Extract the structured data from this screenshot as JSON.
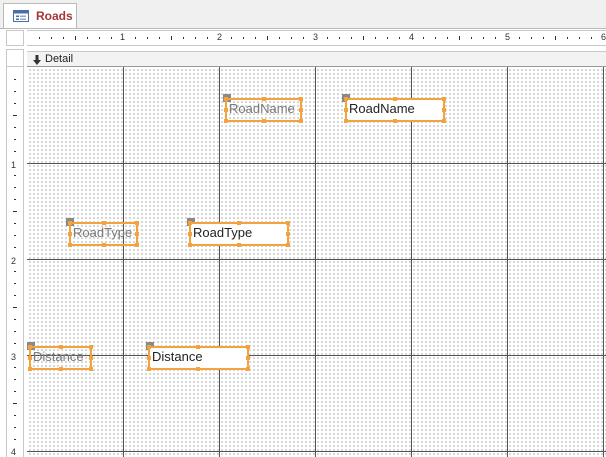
{
  "tab": {
    "title": "Roads",
    "icon": "form-icon"
  },
  "ruler": {
    "horizontal_labels": [
      "1",
      "2",
      "3",
      "4",
      "5",
      "6"
    ],
    "vertical_labels": [
      "1",
      "2",
      "3",
      "4"
    ]
  },
  "section": {
    "name": "Detail",
    "icon": "section-arrow-icon"
  },
  "controls": {
    "roadname_label": "RoadName",
    "roadname_textbox": "RoadName",
    "roadtype_label": "RoadType",
    "roadtype_textbox": "RoadType",
    "distance_label": "Distance",
    "distance_textbox": "Distance"
  },
  "colors": {
    "selection": "#f4a23c",
    "tab_text": "#a4373a",
    "grid_line": "#555555"
  }
}
